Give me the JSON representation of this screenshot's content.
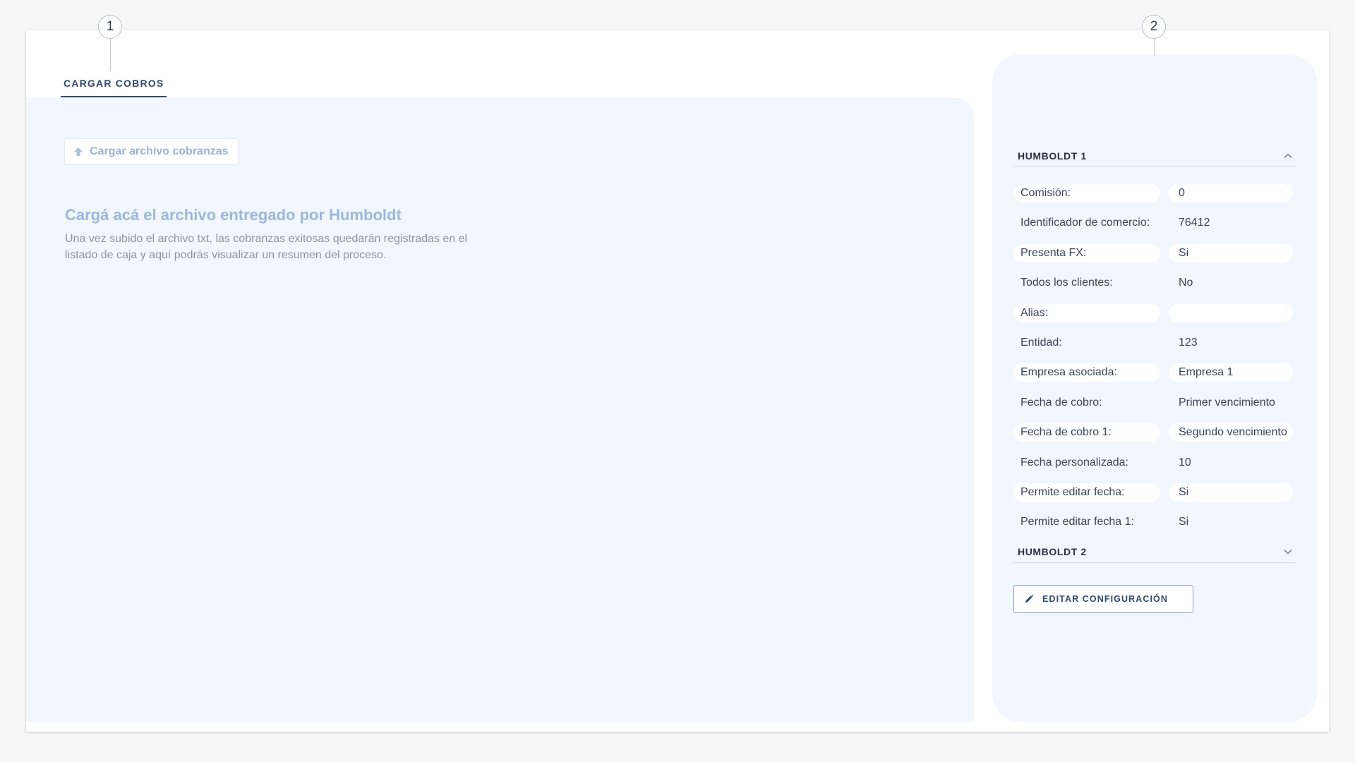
{
  "callouts": [
    "1",
    "2"
  ],
  "tabs": [
    {
      "label": "CARGAR COBROS",
      "active": true
    }
  ],
  "upload": {
    "button_label": "Cargar archivo cobranzas",
    "icon": "upload-arrow-icon"
  },
  "empty_state": {
    "title": "Cargá acá el archivo entregado por Humboldt",
    "description": "Una vez subido el archivo txt, las cobranzas exitosas quedarán registradas en el listado de caja y aquí podrás visualizar un resumen del proceso."
  },
  "config": {
    "sections": [
      {
        "title": "HUMBOLDT 1",
        "expanded": true,
        "icon": "chevron-up-icon",
        "rows": [
          {
            "label": "Comisión:",
            "value": "0"
          },
          {
            "label": "Identificador de comercio:",
            "value": "76412"
          },
          {
            "label": "Presenta FX:",
            "value": "Si"
          },
          {
            "label": "Todos los clientes:",
            "value": "No"
          },
          {
            "label": "Alias:",
            "value": ""
          },
          {
            "label": "Entidad:",
            "value": "123"
          },
          {
            "label": "Empresa asociada:",
            "value": "Empresa 1"
          },
          {
            "label": "Fecha de cobro:",
            "value": "Primer vencimiento"
          },
          {
            "label": "Fecha de cobro 1:",
            "value": "Segundo vencimiento"
          },
          {
            "label": "Fecha personalizada:",
            "value": "10"
          },
          {
            "label": "Permite editar fecha:",
            "value": "Si"
          },
          {
            "label": "Permite editar fecha 1:",
            "value": "Si"
          }
        ]
      },
      {
        "title": "HUMBOLDT 2",
        "expanded": false,
        "icon": "chevron-down-icon"
      }
    ],
    "edit_button_label": "EDITAR CONFIGURACIÓN",
    "edit_icon": "pencil-icon"
  },
  "colors": {
    "accent": "#2f4a6d",
    "panel_bg": "#f2f6fe",
    "muted_link": "#98b3d6",
    "row_shade": "#ffffff"
  }
}
